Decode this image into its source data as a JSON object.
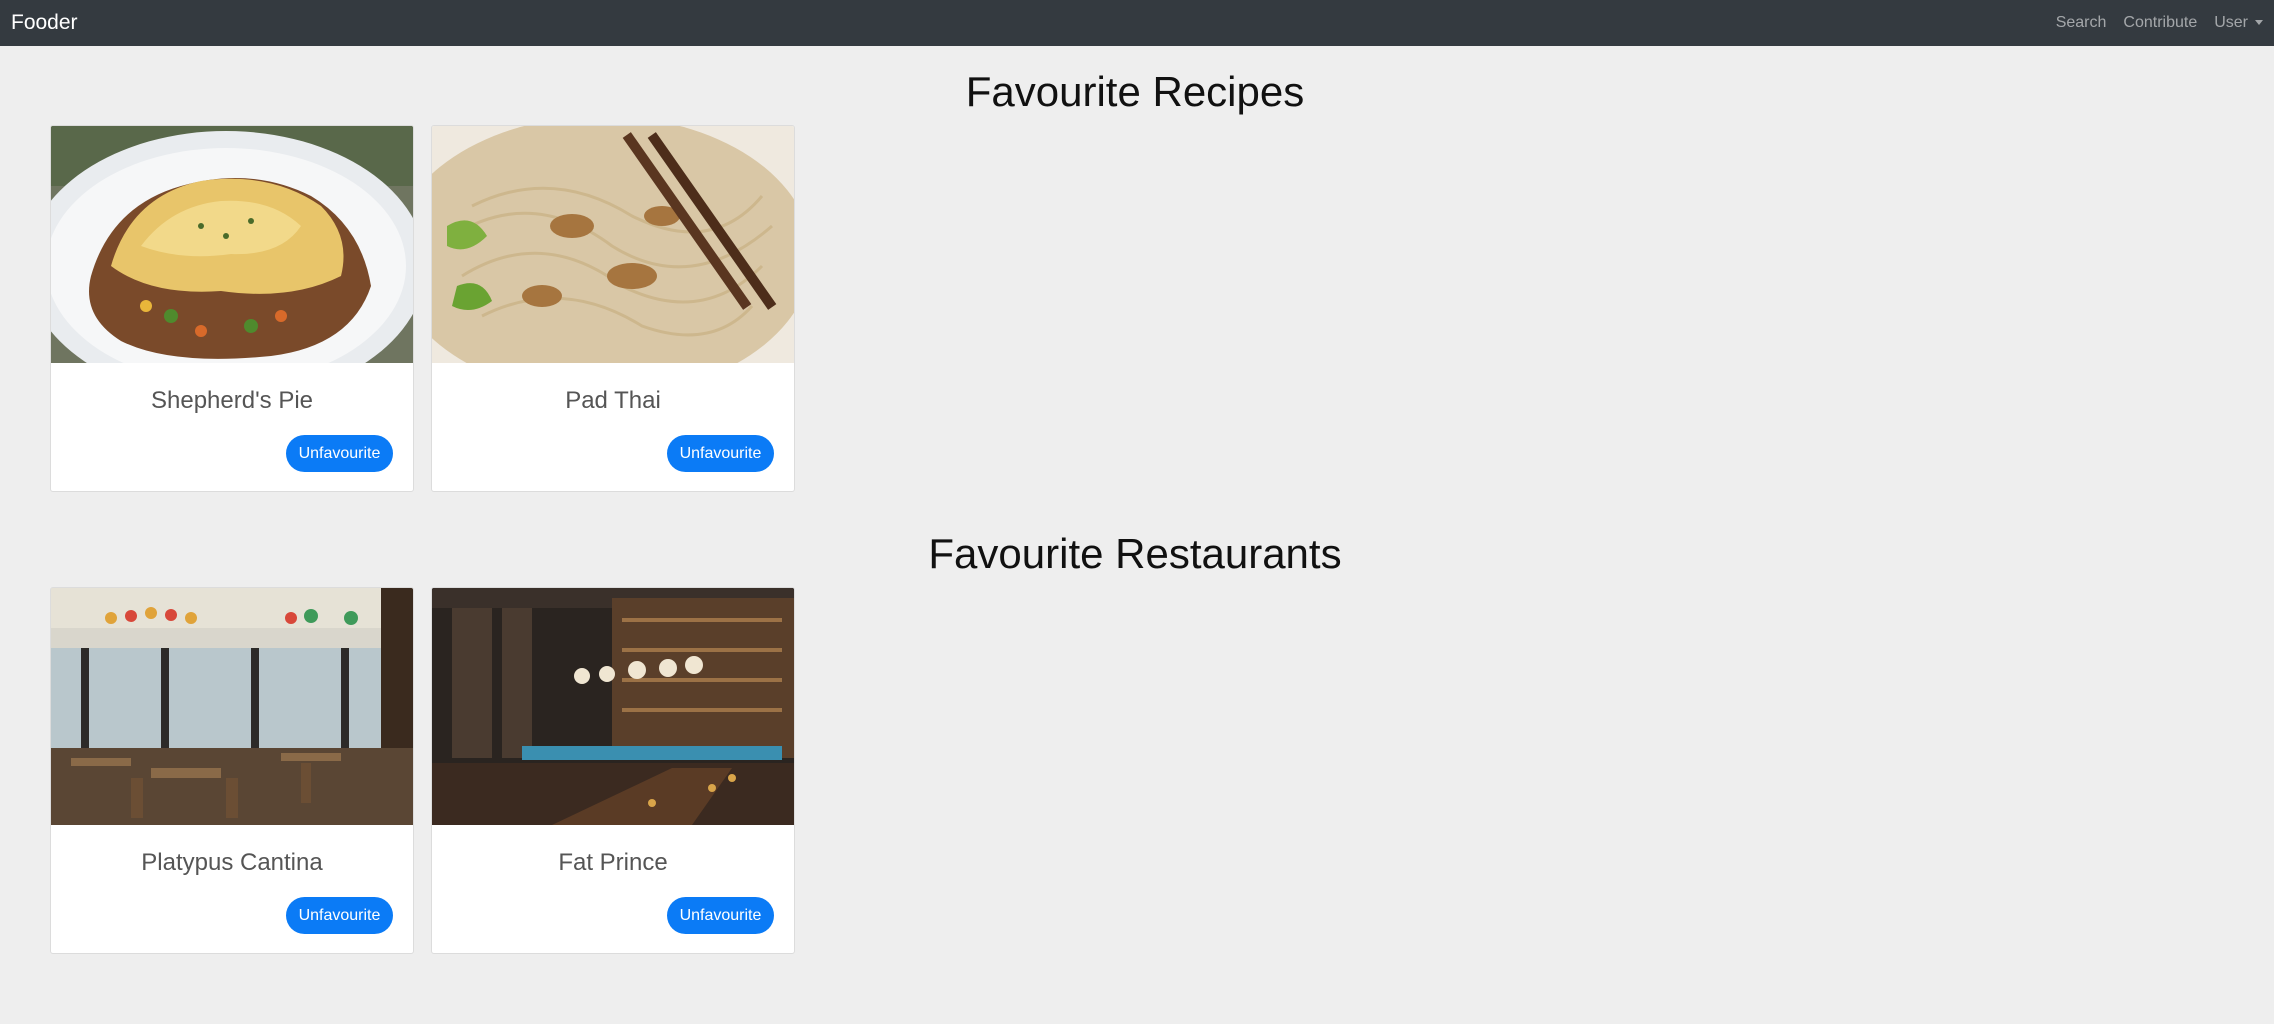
{
  "navbar": {
    "brand": "Fooder",
    "links": {
      "search": "Search",
      "contribute": "Contribute",
      "user": "User"
    }
  },
  "recipes": {
    "title": "Favourite Recipes",
    "items": [
      {
        "name": "Shepherd's Pie",
        "button": "Unfavourite"
      },
      {
        "name": "Pad Thai",
        "button": "Unfavourite"
      }
    ]
  },
  "restaurants": {
    "title": "Favourite Restaurants",
    "items": [
      {
        "name": "Platypus Cantina",
        "button": "Unfavourite"
      },
      {
        "name": "Fat Prince",
        "button": "Unfavourite"
      }
    ]
  },
  "colors": {
    "navbar_bg": "#343a40",
    "page_bg": "#eeeeee",
    "button_bg": "#0b7bf6"
  }
}
